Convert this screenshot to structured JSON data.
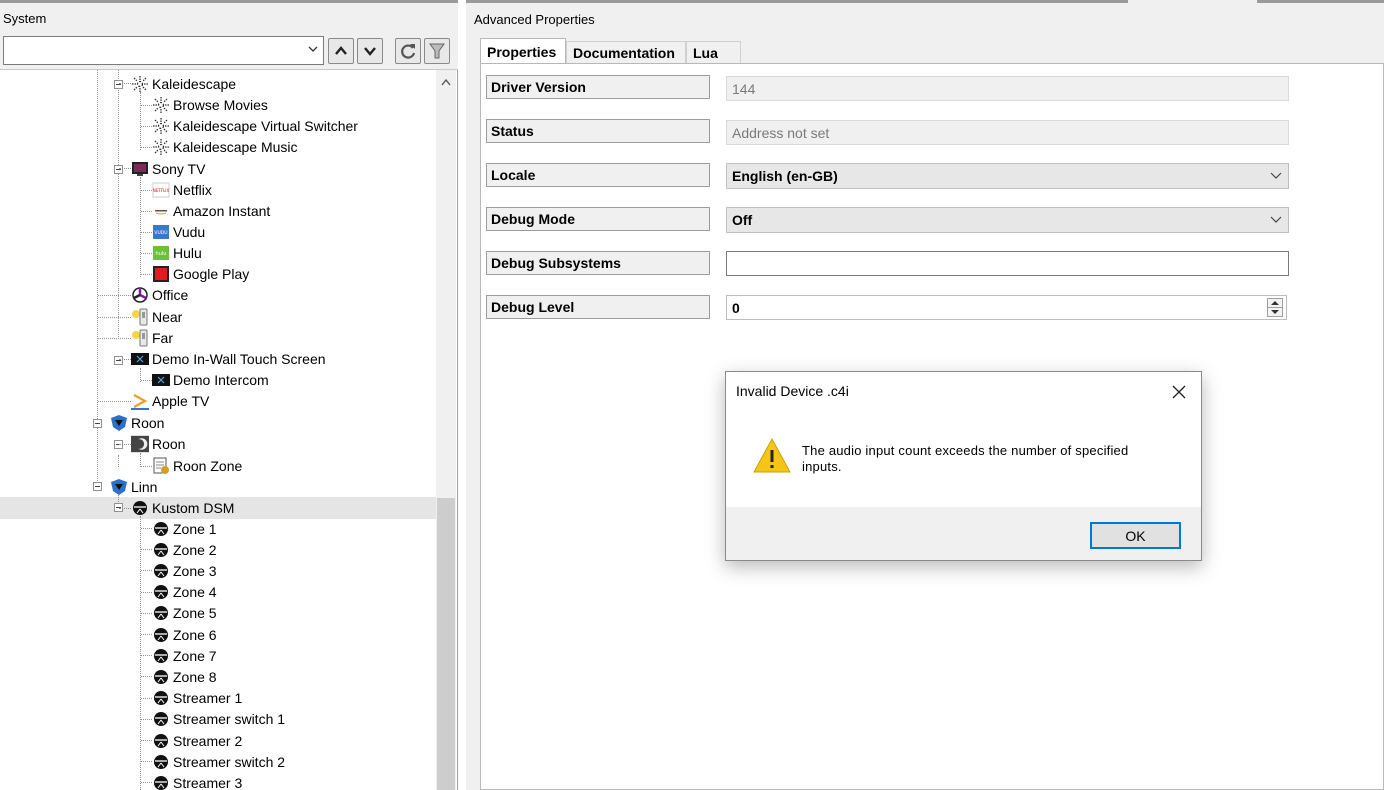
{
  "system_panel": {
    "title": "System",
    "combo_value": "",
    "tree": [
      {
        "label": "Kaleidescape",
        "icon": "kaleidescape-icon",
        "level": 1
      },
      {
        "label": "Browse Movies",
        "icon": "kaleidescape-icon",
        "level": 2
      },
      {
        "label": "Kaleidescape Virtual Switcher",
        "icon": "kaleidescape-icon",
        "level": 2
      },
      {
        "label": "Kaleidescape Music",
        "icon": "kaleidescape-icon",
        "level": 2
      },
      {
        "label": "Sony TV",
        "icon": "tv-icon",
        "level": 1
      },
      {
        "label": "Netflix",
        "icon": "netflix-icon",
        "level": 2
      },
      {
        "label": "Amazon Instant",
        "icon": "amazon-icon",
        "level": 2
      },
      {
        "label": "Vudu",
        "icon": "vudu-icon",
        "level": 2
      },
      {
        "label": "Hulu",
        "icon": "hulu-icon",
        "level": 2
      },
      {
        "label": "Google Play",
        "icon": "google-play-icon",
        "level": 2
      },
      {
        "label": "Office",
        "icon": "room-icon",
        "level": 1
      },
      {
        "label": "Near",
        "icon": "light-switch-icon",
        "level": 1
      },
      {
        "label": "Far",
        "icon": "light-switch-icon",
        "level": 1
      },
      {
        "label": "Demo In-Wall Touch Screen",
        "icon": "touch-screen-icon",
        "level": 1
      },
      {
        "label": "Demo Intercom",
        "icon": "touch-screen-icon",
        "level": 2
      },
      {
        "label": "Apple TV",
        "icon": "apple-tv-icon",
        "level": 1
      },
      {
        "label": "Roon",
        "icon": "agent-shield-icon",
        "level": 0
      },
      {
        "label": "Roon",
        "icon": "roon-icon",
        "level": 1
      },
      {
        "label": "Roon Zone",
        "icon": "zone-icon",
        "level": 2
      },
      {
        "label": "Linn",
        "icon": "agent-shield-icon",
        "level": 0
      },
      {
        "label": "Kustom DSM",
        "icon": "linn-icon",
        "level": 1
      },
      {
        "label": "Zone 1",
        "icon": "linn-icon",
        "level": 2
      },
      {
        "label": "Zone 2",
        "icon": "linn-icon",
        "level": 2
      },
      {
        "label": "Zone 3",
        "icon": "linn-icon",
        "level": 2
      },
      {
        "label": "Zone 4",
        "icon": "linn-icon",
        "level": 2
      },
      {
        "label": "Zone 5",
        "icon": "linn-icon",
        "level": 2
      },
      {
        "label": "Zone 6",
        "icon": "linn-icon",
        "level": 2
      },
      {
        "label": "Zone 7",
        "icon": "linn-icon",
        "level": 2
      },
      {
        "label": "Zone 8",
        "icon": "linn-icon",
        "level": 2
      },
      {
        "label": "Streamer 1",
        "icon": "linn-icon",
        "level": 2
      },
      {
        "label": "Streamer switch 1",
        "icon": "linn-icon",
        "level": 2
      },
      {
        "label": "Streamer 2",
        "icon": "linn-icon",
        "level": 2
      },
      {
        "label": "Streamer switch 2",
        "icon": "linn-icon",
        "level": 2
      },
      {
        "label": "Streamer 3",
        "icon": "linn-icon",
        "level": 2
      }
    ],
    "selected_item": "Kustom DSM"
  },
  "advanced_properties": {
    "title": "Advanced Properties",
    "tabs": [
      {
        "label": "Properties",
        "active": true
      },
      {
        "label": "Documentation",
        "active": false
      },
      {
        "label": "Lua",
        "active": false
      }
    ],
    "properties": [
      {
        "label": "Driver Version",
        "value": "144",
        "kind": "readonly"
      },
      {
        "label": "Status",
        "value": "Address not set",
        "kind": "readonly"
      },
      {
        "label": "Locale",
        "value": "English (en-GB)",
        "kind": "dropdown"
      },
      {
        "label": "Debug Mode",
        "value": "Off",
        "kind": "dropdown"
      },
      {
        "label": "Debug Subsystems",
        "value": "",
        "kind": "text"
      },
      {
        "label": "Debug Level",
        "value": "0",
        "kind": "number"
      }
    ]
  },
  "dialog": {
    "title": "Invalid Device .c4i",
    "message_line1": "The audio input count exceeds the number of specified",
    "message_line2": "inputs.",
    "ok_label": "OK",
    "icon": "warning-icon"
  },
  "colors": {
    "accent": "#0078d7",
    "warning": "#f6c515",
    "selection": "#e5e5e5"
  }
}
